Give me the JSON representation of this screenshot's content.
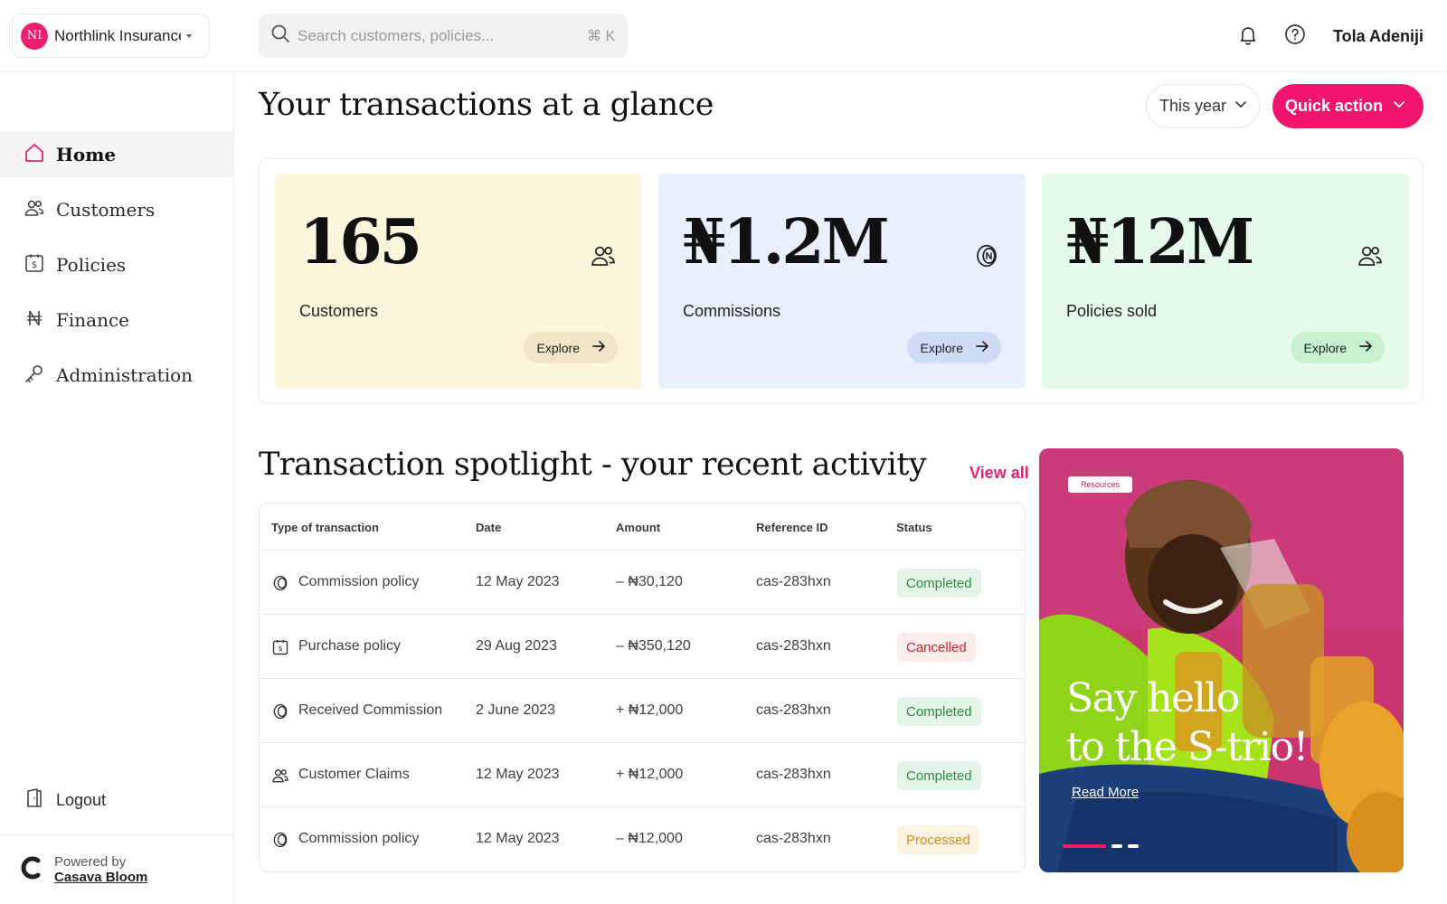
{
  "org": {
    "initials": "NI",
    "name": "Northlink Insurance"
  },
  "search": {
    "placeholder": "Search customers, policies...",
    "shortcut": "⌘ K"
  },
  "user": {
    "name": "Tola Adeniji"
  },
  "sidebar": {
    "items": [
      {
        "label": "Home",
        "icon": "home-icon",
        "active": true
      },
      {
        "label": "Customers",
        "icon": "users-icon"
      },
      {
        "label": "Policies",
        "icon": "policy-document-icon"
      },
      {
        "label": "Finance",
        "icon": "naira-icon"
      },
      {
        "label": "Administration",
        "icon": "key-icon"
      }
    ],
    "logout_label": "Logout",
    "powered_by": "Powered by",
    "powered_brand": "Casava Bloom"
  },
  "header": {
    "title": "Your transactions at a glance",
    "period": "This year",
    "quick_action": "Quick action"
  },
  "stats": [
    {
      "value": "165",
      "label": "Customers",
      "explore": "Explore",
      "bg": "#fdf6dc",
      "button_bg": "#efe6c8",
      "icon": "users-icon"
    },
    {
      "value": "₦1.2M",
      "label": "Commissions",
      "explore": "Explore",
      "bg": "#e8f0fd",
      "button_bg": "#cfdcf7",
      "icon": "coin-icon"
    },
    {
      "value": "₦12M",
      "label": "Policies sold",
      "explore": "Explore",
      "bg": "#e6faea",
      "button_bg": "#c7f0d0",
      "icon": "users-icon"
    }
  ],
  "activity": {
    "title": "Transaction spotlight - your recent activity",
    "view_all": "View all",
    "columns": [
      "Type of transaction",
      "Date",
      "Amount",
      "Reference ID",
      "Status"
    ],
    "rows": [
      {
        "type": "Commission policy",
        "icon": "coin-icon",
        "date": "12 May 2023",
        "amount": "– ₦30,120",
        "ref": "cas-283hxn",
        "status": "Completed",
        "status_kind": "completed"
      },
      {
        "type": "Purchase policy",
        "icon": "policy-document-icon",
        "date": "29 Aug 2023",
        "amount": "– ₦350,120",
        "ref": "cas-283hxn",
        "status": "Cancelled",
        "status_kind": "cancelled"
      },
      {
        "type": "Received Commission",
        "icon": "coin-icon",
        "date": "2 June 2023",
        "amount": "+ ₦12,000",
        "ref": "cas-283hxn",
        "status": "Completed",
        "status_kind": "completed"
      },
      {
        "type": "Customer Claims",
        "icon": "users-icon",
        "date": "12 May 2023",
        "amount": "+ ₦12,000",
        "ref": "cas-283hxn",
        "status": "Completed",
        "status_kind": "completed"
      },
      {
        "type": "Commission policy",
        "icon": "coin-icon",
        "date": "12 May 2023",
        "amount": "– ₦12,000",
        "ref": "cas-283hxn",
        "status": "Processed",
        "status_kind": "processed"
      }
    ]
  },
  "promo": {
    "tag": "Resources",
    "title_line1": "Say hello",
    "title_line2": "to the S-trio!",
    "link": "Read More",
    "slides": 3,
    "active_slide": 1
  },
  "colors": {
    "accent": "#ee1f6e",
    "promo_bg": "#c9356f",
    "promo_jacket": "#a6e21a"
  }
}
